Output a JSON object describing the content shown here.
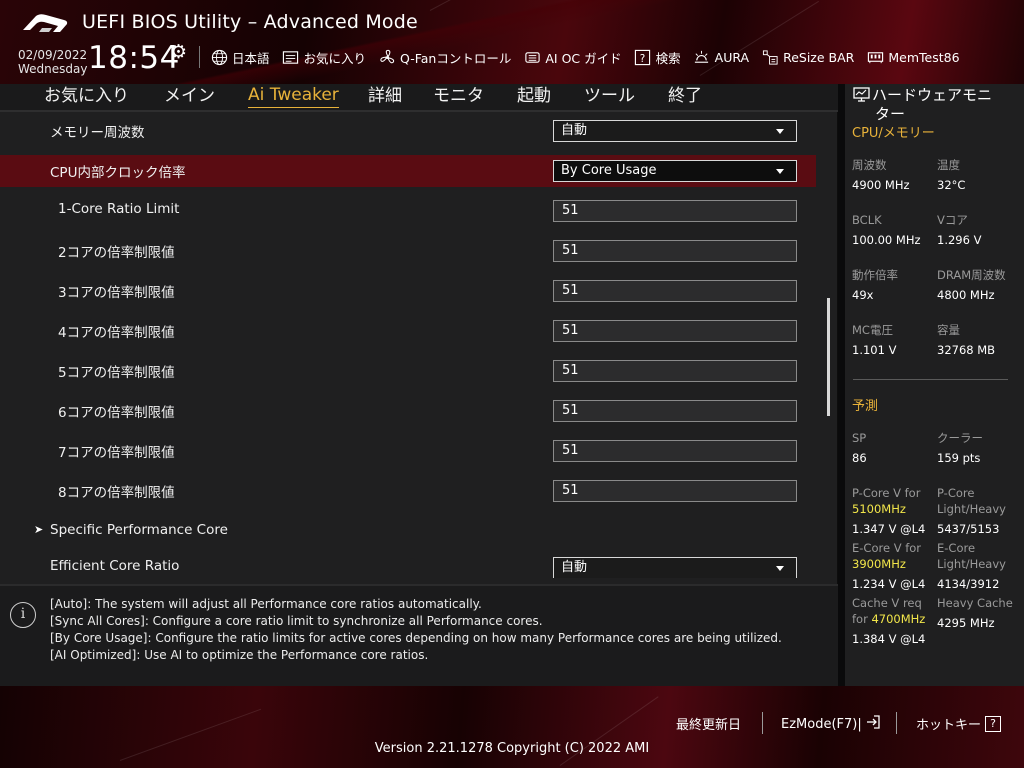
{
  "header": {
    "title": "UEFI BIOS Utility – Advanced Mode",
    "date": "02/09/2022",
    "weekday": "Wednesday",
    "time": "18:54",
    "toolbar": [
      {
        "icon": "globe-icon",
        "label": "日本語"
      },
      {
        "icon": "bookmark-icon",
        "label": "お気に入り"
      },
      {
        "icon": "fan-icon",
        "label": "Q-Fanコントロール"
      },
      {
        "icon": "ai-oc-icon",
        "label": "AI OC ガイド"
      },
      {
        "icon": "help-search-icon",
        "label": "検索"
      },
      {
        "icon": "aura-icon",
        "label": "AURA"
      },
      {
        "icon": "resize-bar-icon",
        "label": "ReSize BAR"
      },
      {
        "icon": "memtest-icon",
        "label": "MemTest86"
      }
    ]
  },
  "tabs": [
    "お気に入り",
    "メイン",
    "Ai Tweaker",
    "詳細",
    "モニタ",
    "起動",
    "ツール",
    "終了"
  ],
  "active_tab": "Ai Tweaker",
  "settings": [
    {
      "label": "メモリー周波数",
      "value": "自動",
      "kind": "select"
    },
    {
      "label": "CPU内部クロック倍率",
      "value": "By Core Usage",
      "kind": "select",
      "selected": true
    },
    {
      "label": "1-Core Ratio Limit",
      "value": "51",
      "kind": "number"
    },
    {
      "label": "2コアの倍率制限値",
      "value": "51",
      "kind": "number"
    },
    {
      "label": "3コアの倍率制限値",
      "value": "51",
      "kind": "number"
    },
    {
      "label": "4コアの倍率制限値",
      "value": "51",
      "kind": "number"
    },
    {
      "label": "5コアの倍率制限値",
      "value": "51",
      "kind": "number"
    },
    {
      "label": "6コアの倍率制限値",
      "value": "51",
      "kind": "number"
    },
    {
      "label": "7コアの倍率制限値",
      "value": "51",
      "kind": "number"
    },
    {
      "label": "8コアの倍率制限値",
      "value": "51",
      "kind": "number"
    },
    {
      "label": "Specific Performance Core",
      "kind": "submenu"
    },
    {
      "label": "Efficient Core Ratio",
      "value": "自動",
      "kind": "select"
    }
  ],
  "help": [
    "[Auto]: The system will adjust all Performance core ratios automatically.",
    "[Sync All Cores]: Configure a core ratio limit to synchronize all Performance cores.",
    "[By Core Usage]: Configure the ratio limits for active cores depending on how many Performance cores are being utilized.",
    "[AI Optimized]: Use AI to optimize the Performance core ratios."
  ],
  "hw_monitor": {
    "title_line1": "ハードウェアモニ",
    "title_line2": "ター",
    "cpu_section": "CPU/メモリー",
    "cpu_items": [
      {
        "label": "周波数",
        "value": "4900 MHz"
      },
      {
        "label": "温度",
        "value": "32°C"
      },
      {
        "label": "BCLK",
        "value": "100.00 MHz"
      },
      {
        "label": "Vコア",
        "value": "1.296 V"
      },
      {
        "label": "動作倍率",
        "value": "49x"
      },
      {
        "label": "DRAM周波数",
        "value": "4800 MHz"
      },
      {
        "label": "MC電圧",
        "value": "1.101 V"
      },
      {
        "label": "容量",
        "value": "32768 MB"
      }
    ],
    "predict_section": "予測",
    "sp_label": "SP",
    "sp_value": "86",
    "cooler_label": "クーラー",
    "cooler_value": "159 pts",
    "pcore_v_label": "P-Core V for",
    "pcore_v_freq": "5100MHz",
    "pcore_v_value": "1.347 V @L4",
    "pcore_lh_label1": "P-Core",
    "pcore_lh_label2": "Light/Heavy",
    "pcore_lh_value": "5437/5153",
    "ecore_v_label": "E-Core V for",
    "ecore_v_freq": "3900MHz",
    "ecore_v_value": "1.234 V @L4",
    "ecore_lh_label1": "E-Core",
    "ecore_lh_label2": "Light/Heavy",
    "ecore_lh_value": "4134/3912",
    "cache_label1": "Cache V req",
    "cache_label2_prefix": "for ",
    "cache_freq": "4700MHz",
    "cache_value": "1.384 V @L4",
    "heavy_cache_label": "Heavy Cache",
    "heavy_cache_value": "4295 MHz"
  },
  "footer": {
    "last_modified": "最終更新日",
    "ezmode": "EzMode(F7)|",
    "hotkeys": "ホットキー",
    "hotkeys_key": "?",
    "version": "Version 2.21.1278 Copyright (C) 2022 AMI"
  },
  "colors": {
    "accent": "#e8b23a",
    "highlight_row": "#5a0c12",
    "yellow_text": "#f2e64a"
  }
}
